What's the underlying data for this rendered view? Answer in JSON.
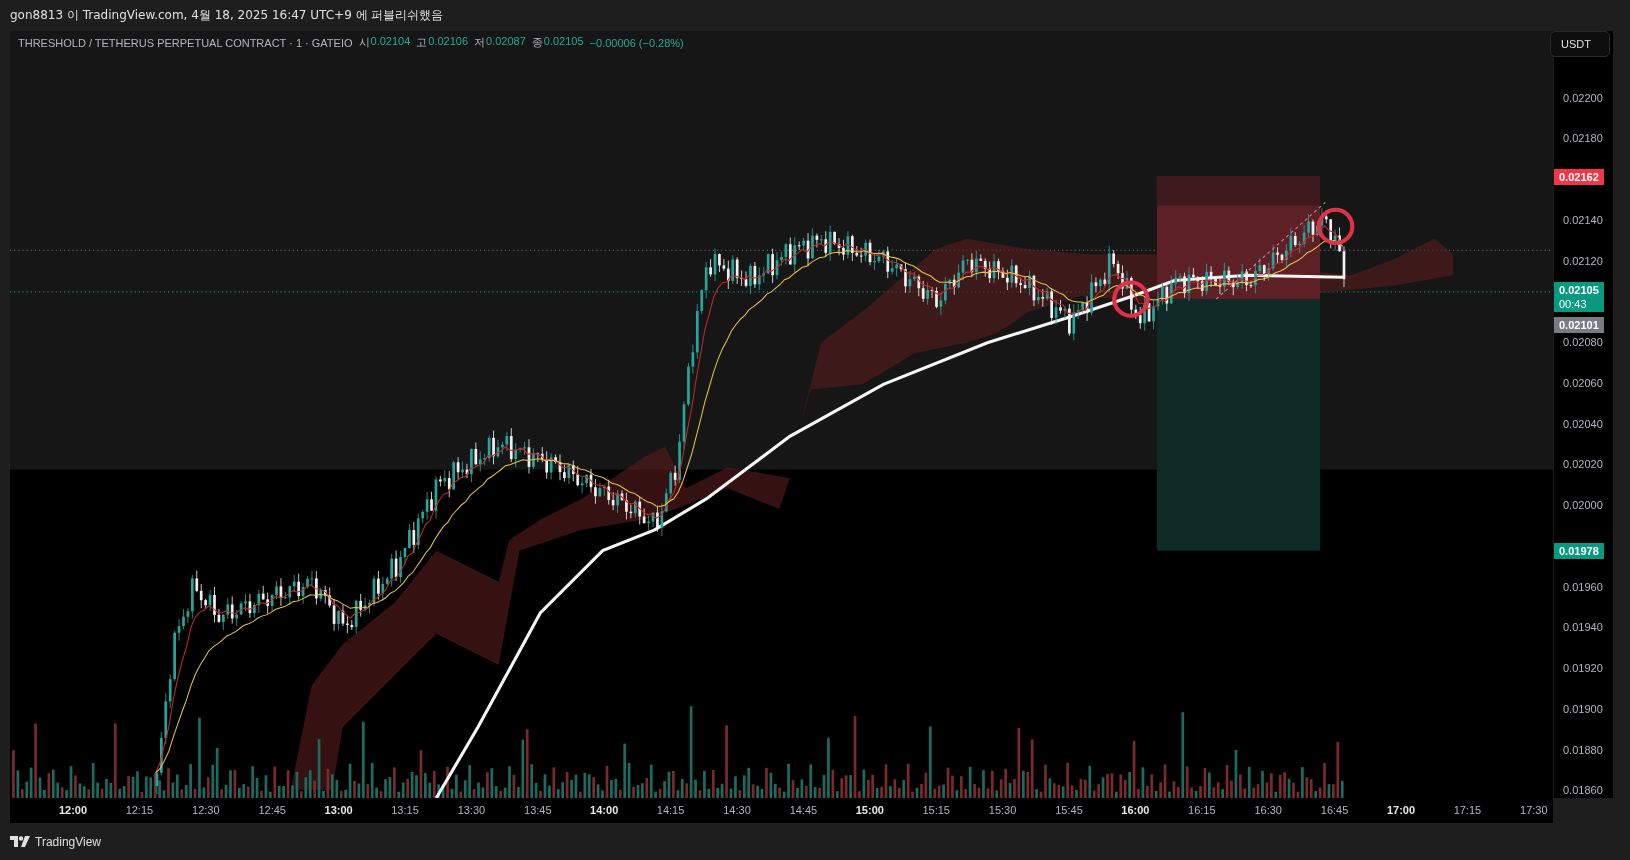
{
  "publish_note": "gon8813 이 TradingView.com, 4월 18, 2025 16:47 UTC+9 에 퍼블리쉬했음",
  "legend": {
    "symbol": "THRESHOLD / TETHERUS PERPETUAL CONTRACT · 1 · GATEIO",
    "ohlc": [
      {
        "label": "시",
        "value": "0.02104"
      },
      {
        "label": "고",
        "value": "0.02106"
      },
      {
        "label": "저",
        "value": "0.02087"
      },
      {
        "label": "종",
        "value": "0.02105"
      }
    ],
    "change": "−0.00006 (−0.28%)"
  },
  "currency_button": "USDT",
  "price_axis": {
    "ticks": [
      "0.02200",
      "0.02180",
      "0.02140",
      "0.02120",
      "0.02080",
      "0.02060",
      "0.02040",
      "0.02020",
      "0.02000",
      "0.01960",
      "0.01940",
      "0.01920",
      "0.01900",
      "0.01880",
      "0.01860"
    ],
    "badges": [
      {
        "text": "0.02162",
        "color": "#f23645"
      },
      {
        "text": "0.02105",
        "sub": "00:43",
        "color": "#089981"
      },
      {
        "text": "0.02101",
        "color": "#787b86"
      },
      {
        "text": "0.01978",
        "color": "#089981"
      }
    ]
  },
  "time_axis": [
    {
      "label": "12:00",
      "major": true
    },
    {
      "label": "12:15",
      "major": false
    },
    {
      "label": "12:30",
      "major": false
    },
    {
      "label": "12:45",
      "major": false
    },
    {
      "label": "13:00",
      "major": true
    },
    {
      "label": "13:15",
      "major": false
    },
    {
      "label": "13:30",
      "major": false
    },
    {
      "label": "13:45",
      "major": false
    },
    {
      "label": "14:00",
      "major": true
    },
    {
      "label": "14:15",
      "major": false
    },
    {
      "label": "14:30",
      "major": false
    },
    {
      "label": "14:45",
      "major": false
    },
    {
      "label": "15:00",
      "major": true
    },
    {
      "label": "15:15",
      "major": false
    },
    {
      "label": "15:30",
      "major": false
    },
    {
      "label": "15:45",
      "major": false
    },
    {
      "label": "16:00",
      "major": true
    },
    {
      "label": "16:15",
      "major": false
    },
    {
      "label": "16:30",
      "major": false
    },
    {
      "label": "16:45",
      "major": false
    },
    {
      "label": "17:00",
      "major": true
    },
    {
      "label": "17:15",
      "major": false
    },
    {
      "label": "17:30",
      "major": false
    }
  ],
  "footer": {
    "brand": "TradingView"
  }
}
